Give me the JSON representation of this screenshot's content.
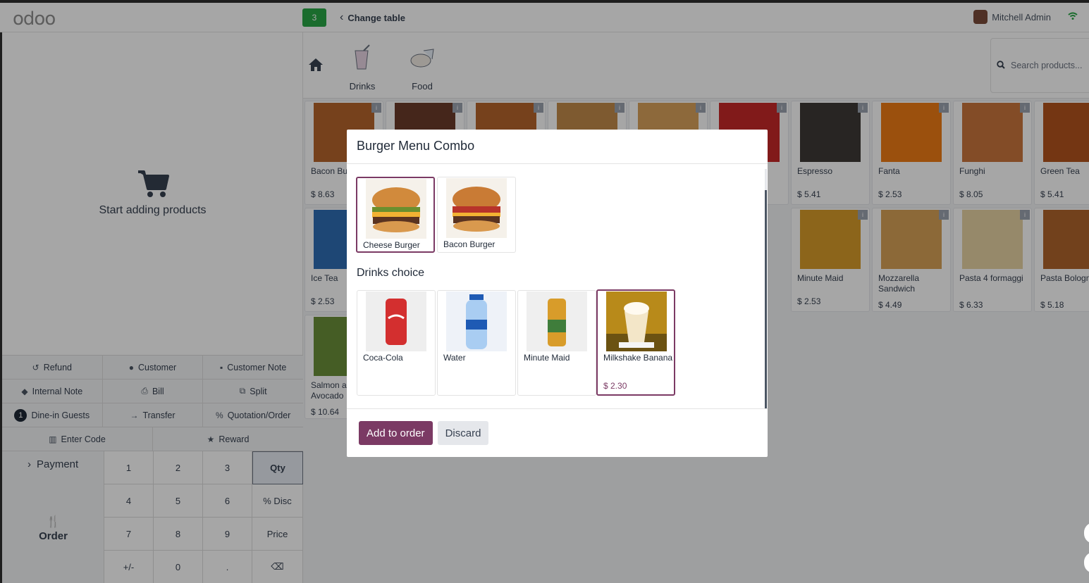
{
  "topbar": {
    "logo": "odoo",
    "table_number": "3",
    "change_table": "Change table",
    "user_name": "Mitchell Admin"
  },
  "order": {
    "empty_text": "Start adding products"
  },
  "controls": {
    "row1": [
      "Refund",
      "Customer",
      "Customer Note"
    ],
    "row2": [
      "Internal Note",
      "Bill",
      "Split"
    ],
    "row3": {
      "guests_count": "1",
      "guests": "Dine-in Guests",
      "transfer": "Transfer",
      "quotation": "Quotation/Order"
    },
    "row4": [
      "Enter Code",
      "Reward"
    ]
  },
  "numpad": {
    "payment": "Payment",
    "order": "Order",
    "keys": [
      "1",
      "2",
      "3",
      "Qty",
      "4",
      "5",
      "6",
      "% Disc",
      "7",
      "8",
      "9",
      "Price",
      "+/-",
      "0",
      ".",
      "⌫"
    ]
  },
  "categories": [
    {
      "label": "Drinks",
      "icon": "drinks-icon"
    },
    {
      "label": "Food",
      "icon": "food-icon"
    }
  ],
  "search": {
    "placeholder": "Search products..."
  },
  "products": [
    {
      "name": "Bacon Burger",
      "price": "$ 8.63",
      "color": "#b5652b"
    },
    {
      "name": "",
      "price": "",
      "color": "#6b3b2a"
    },
    {
      "name": "",
      "price": "",
      "color": "#b5652b"
    },
    {
      "name": "",
      "price": "",
      "color": "#c28a4a"
    },
    {
      "name": "",
      "price": "",
      "color": "#d9a25b"
    },
    {
      "name": "",
      "price": "",
      "color": "#c62828"
    },
    {
      "name": "Espresso",
      "price": "$ 5.41",
      "color": "#3e3a36"
    },
    {
      "name": "Fanta",
      "price": "$ 2.53",
      "color": "#ef7c14"
    },
    {
      "name": "Funghi",
      "price": "$ 8.05",
      "color": "#c9763c"
    },
    {
      "name": "Green Tea",
      "price": "$ 5.41",
      "color": "#b3541e"
    },
    {
      "name": "Ice Tea",
      "price": "$ 2.53",
      "color": "#2e6db4"
    },
    {
      "name": "Minute Maid",
      "price": "$ 2.53",
      "color": "#d89c2a"
    },
    {
      "name": "Mozzarella Sandwich",
      "price": "$ 4.49",
      "color": "#d7a256"
    },
    {
      "name": "Pasta 4 formaggi",
      "price": "$ 6.33",
      "color": "#e6d3a3"
    },
    {
      "name": "Pasta Bolognese",
      "price": "$ 5.18",
      "color": "#b0642b"
    },
    {
      "name": "Salmon and Avocado",
      "price": "$ 10.64",
      "color": "#6a8f3a"
    }
  ],
  "modal": {
    "title": "Burger Menu Combo",
    "burgers": [
      {
        "name": "Cheese Burger",
        "selected": true,
        "color": "#c47a32"
      },
      {
        "name": "Bacon Burger",
        "selected": false,
        "color": "#b5502b"
      }
    ],
    "drinks_title": "Drinks choice",
    "drinks": [
      {
        "name": "Coca-Cola",
        "price": "",
        "selected": false,
        "color": "#d32f2f"
      },
      {
        "name": "Water",
        "price": "",
        "selected": false,
        "color": "#8ab6e6"
      },
      {
        "name": "Minute Maid",
        "price": "",
        "selected": false,
        "color": "#d89c2a"
      },
      {
        "name": "Milkshake Banana",
        "price": "$ 2.30",
        "selected": true,
        "color": "#c9a227"
      }
    ],
    "add_button": "Add to order",
    "discard_button": "Discard"
  },
  "colors": {
    "primary": "#7b3a64",
    "table_badge": "#28a745"
  }
}
